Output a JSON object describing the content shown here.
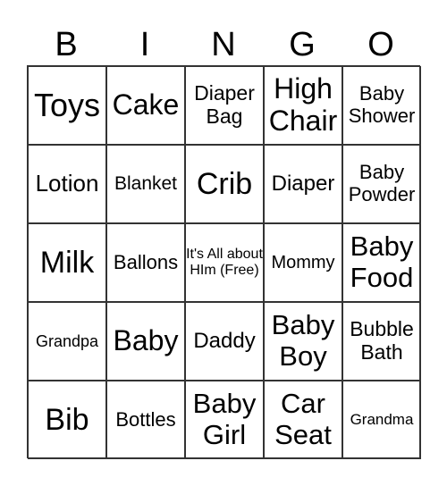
{
  "header": [
    "B",
    "I",
    "N",
    "G",
    "O"
  ],
  "cells": [
    [
      "Toys",
      "Cake",
      "Diaper Bag",
      "High Chair",
      "Baby Shower"
    ],
    [
      "Lotion",
      "Blanket",
      "Crib",
      "Diaper",
      "Baby Powder"
    ],
    [
      "Milk",
      "Ballons",
      "It's All about HIm (Free)",
      "Mommy",
      "Baby Food"
    ],
    [
      "Grandpa",
      "Baby",
      "Daddy",
      "Baby Boy",
      "Bubble Bath"
    ],
    [
      "Bib",
      "Bottles",
      "Baby Girl",
      "Car Seat",
      "Grandma"
    ]
  ]
}
